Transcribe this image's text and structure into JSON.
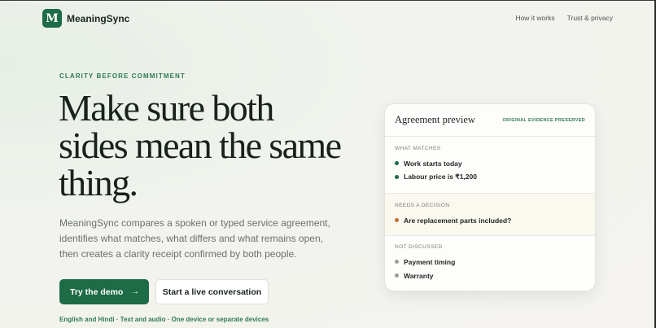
{
  "brand": {
    "logo_letter": "M",
    "name": "MeaningSync",
    "accent": "#1d6b47"
  },
  "nav": {
    "items": [
      "How it works",
      "Trust & privacy"
    ]
  },
  "hero": {
    "eyebrow": "CLARITY BEFORE COMMITMENT",
    "headline_lines": [
      "Make sure both",
      "sides mean the same",
      "thing."
    ],
    "lede": "MeaningSync compares a spoken or typed service agreement, identifies what matches, what differs and what remains open, then creates a clarity receipt confirmed by both people.",
    "primary_cta": "Try the demo",
    "primary_cta_arrow": "→",
    "secondary_cta": "Start a live conversation",
    "footnote": "English and Hindi · Text and audio · One device or separate devices"
  },
  "preview": {
    "title": "Agreement preview",
    "badge": "ORIGINAL EVIDENCE PRESERVED",
    "sections": [
      {
        "label": "WHAT MATCHES",
        "status": "green",
        "items": [
          "Work starts today",
          "Labour price is ₹1,200"
        ]
      },
      {
        "label": "NEEDS A DECISION",
        "status": "amber",
        "items": [
          "Are replacement parts included?"
        ]
      },
      {
        "label": "NOT DISCUSSED",
        "status": "gray",
        "items": [
          "Payment timing",
          "Warranty"
        ]
      }
    ]
  },
  "status_colors": {
    "green": "#1d6b47",
    "amber": "#c0742a",
    "gray": "#9a9d98"
  }
}
